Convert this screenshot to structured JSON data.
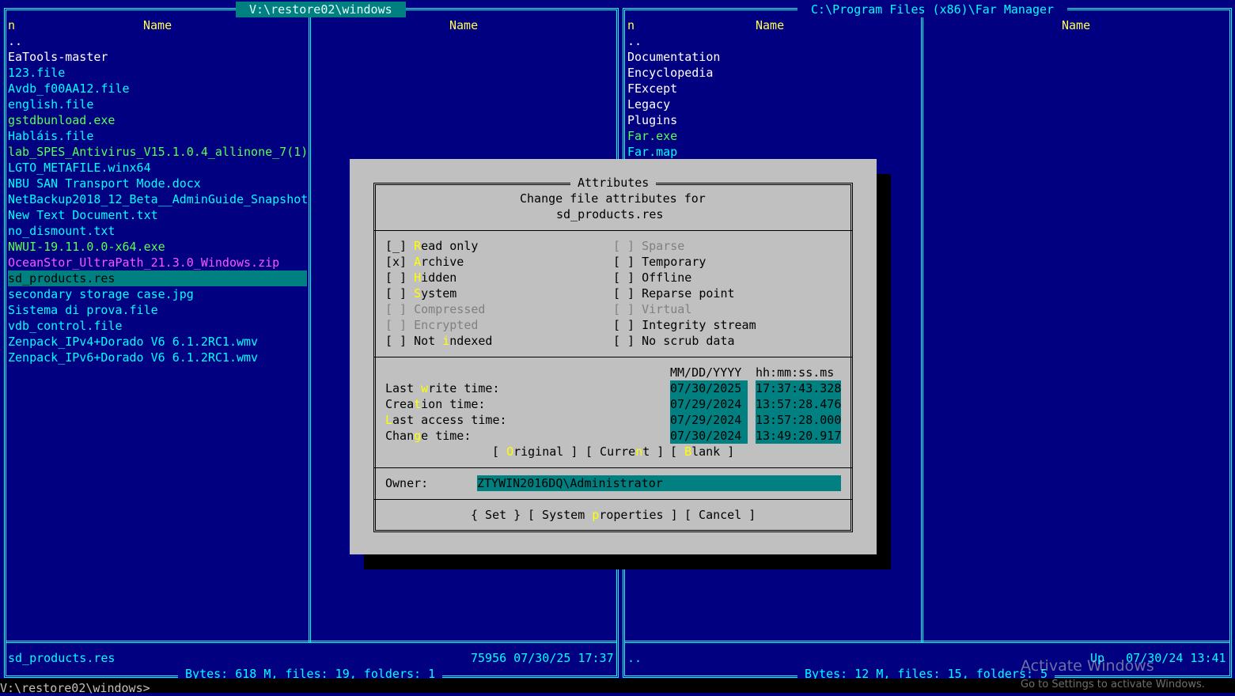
{
  "left_panel": {
    "title": " V:\\restore02\\windows ",
    "col_n": "n",
    "col_name_1": "Name",
    "col_name_2": "Name",
    "items": [
      {
        "name": "..",
        "type": "dir"
      },
      {
        "name": "EaTools-master",
        "type": "dir"
      },
      {
        "name": "123.file",
        "type": "file"
      },
      {
        "name": "Avdb_f00AA12.file",
        "type": "file"
      },
      {
        "name": "english.file",
        "type": "file"
      },
      {
        "name": "gstdbunload.exe",
        "type": "exe"
      },
      {
        "name": "Habláis.file",
        "type": "file"
      },
      {
        "name": "lab_SPES_Antivirus_V15.1.0.4_allinone_7(1)}",
        "type": "exe"
      },
      {
        "name": "LGTO_METAFILE.winx64",
        "type": "file"
      },
      {
        "name": "NBU SAN Transport Mode.docx",
        "type": "file"
      },
      {
        "name": "NetBackup2018_12_Beta__AdminGuide_Snapshot}",
        "type": "file"
      },
      {
        "name": "New Text Document.txt",
        "type": "file"
      },
      {
        "name": "no_dismount.txt",
        "type": "file"
      },
      {
        "name": "NWUI-19.11.0.0-x64.exe",
        "type": "exe"
      },
      {
        "name": "OceanStor_UltraPath_21.3.0_Windows.zip",
        "type": "arc"
      },
      {
        "name": "sd_products.res",
        "type": "selected"
      },
      {
        "name": "secondary storage case.jpg",
        "type": "file"
      },
      {
        "name": "Sistema di prova.file",
        "type": "file"
      },
      {
        "name": "vdb_control.file",
        "type": "file"
      },
      {
        "name": "Zenpack_IPv4+Dorado V6 6.1.2RC1.wmv",
        "type": "file"
      },
      {
        "name": "Zenpack_IPv6+Dorado V6 6.1.2RC1.wmv",
        "type": "file"
      }
    ],
    "status_name": "sd_products.res",
    "status_info": "75956 07/30/25 17:37",
    "summary": " Bytes: 618 M, files: 19, folders: 1 "
  },
  "right_panel": {
    "title": " C:\\Program Files (x86)\\Far Manager ",
    "col_n": "n",
    "col_name_1": "Name",
    "col_name_2": "Name",
    "items": [
      {
        "name": "..",
        "type": "dir"
      },
      {
        "name": "Documentation",
        "type": "dir"
      },
      {
        "name": "Encyclopedia",
        "type": "dir"
      },
      {
        "name": "FExcept",
        "type": "dir"
      },
      {
        "name": "Legacy",
        "type": "dir"
      },
      {
        "name": "Plugins",
        "type": "dir"
      },
      {
        "name": "Far.exe",
        "type": "exe"
      },
      {
        "name": "Far.map",
        "type": "file"
      }
    ],
    "status_name": "..",
    "status_info": "Up   07/30/24 13:41",
    "summary": " Bytes: 12 M, files: 15, folders: 5 "
  },
  "command_line": "V:\\restore02\\windows>",
  "dialog": {
    "title": " Attributes ",
    "subtitle_1": "Change file attributes for",
    "subtitle_2": "sd_products.res",
    "left_attrs": [
      {
        "box": "[_]",
        "hot": "R",
        "rest": "ead only",
        "disabled": false
      },
      {
        "box": "[x]",
        "hot": "A",
        "rest": "rchive",
        "disabled": false
      },
      {
        "box": "[ ]",
        "hot": "H",
        "rest": "idden",
        "disabled": false
      },
      {
        "box": "[ ]",
        "hot": "S",
        "rest": "ystem",
        "disabled": false
      },
      {
        "box": "[ ]",
        "hot": "",
        "rest": "Compressed",
        "disabled": true
      },
      {
        "box": "[ ]",
        "hot": "",
        "rest": "Encrypted",
        "disabled": true
      },
      {
        "box": "[ ]",
        "pre": "Not ",
        "hot": "i",
        "rest": "ndexed",
        "disabled": false
      }
    ],
    "right_attrs": [
      {
        "box": "[ ]",
        "label": "Sparse",
        "disabled": true
      },
      {
        "box": "[ ]",
        "label": "Temporary",
        "disabled": false
      },
      {
        "box": "[ ]",
        "label": "Offline",
        "disabled": false
      },
      {
        "box": "[ ]",
        "label": "Reparse point",
        "disabled": false
      },
      {
        "box": "[ ]",
        "label": "Virtual",
        "disabled": true
      },
      {
        "box": "[ ]",
        "label": "Integrity stream",
        "disabled": false
      },
      {
        "box": "[ ]",
        "label": "No scrub data",
        "disabled": false
      }
    ],
    "date_header": "MM/DD/YYYY",
    "time_header": "hh:mm:ss.ms",
    "times": [
      {
        "pre": "Last ",
        "hot": "w",
        "rest": "rite time:",
        "date": "07/30/2025",
        "time": "17:37:43.328"
      },
      {
        "pre": "Crea",
        "hot": "t",
        "rest": "ion time:",
        "date": "07/29/2024",
        "time": "13:57:28.476"
      },
      {
        "pre": "",
        "hot": "L",
        "rest": "ast access time:",
        "date": "07/29/2024",
        "time": "13:57:28.000"
      },
      {
        "pre": "Chan",
        "hot": "g",
        "rest": "e time:",
        "date": "07/30/2024",
        "time": "13:49:20.917"
      }
    ],
    "btn_original": {
      "pre": "[ ",
      "hot": "O",
      "rest": "riginal ]"
    },
    "btn_current": {
      "pre": "[ Curre",
      "hot": "n",
      "rest": "t ]"
    },
    "btn_blank": {
      "pre": "[ ",
      "hot": "B",
      "rest": "lank ]"
    },
    "owner_label": "Owner:",
    "owner_value": "ZTYWIN2016DQ\\Administrator",
    "btn_set": "{ Set }",
    "btn_sysprops": {
      "pre": "[ System ",
      "hot": "p",
      "rest": "roperties ]"
    },
    "btn_cancel": "[ Cancel ]"
  },
  "watermark": {
    "line1": "Activate Windows",
    "line2": "Go to Settings to activate Windows."
  }
}
